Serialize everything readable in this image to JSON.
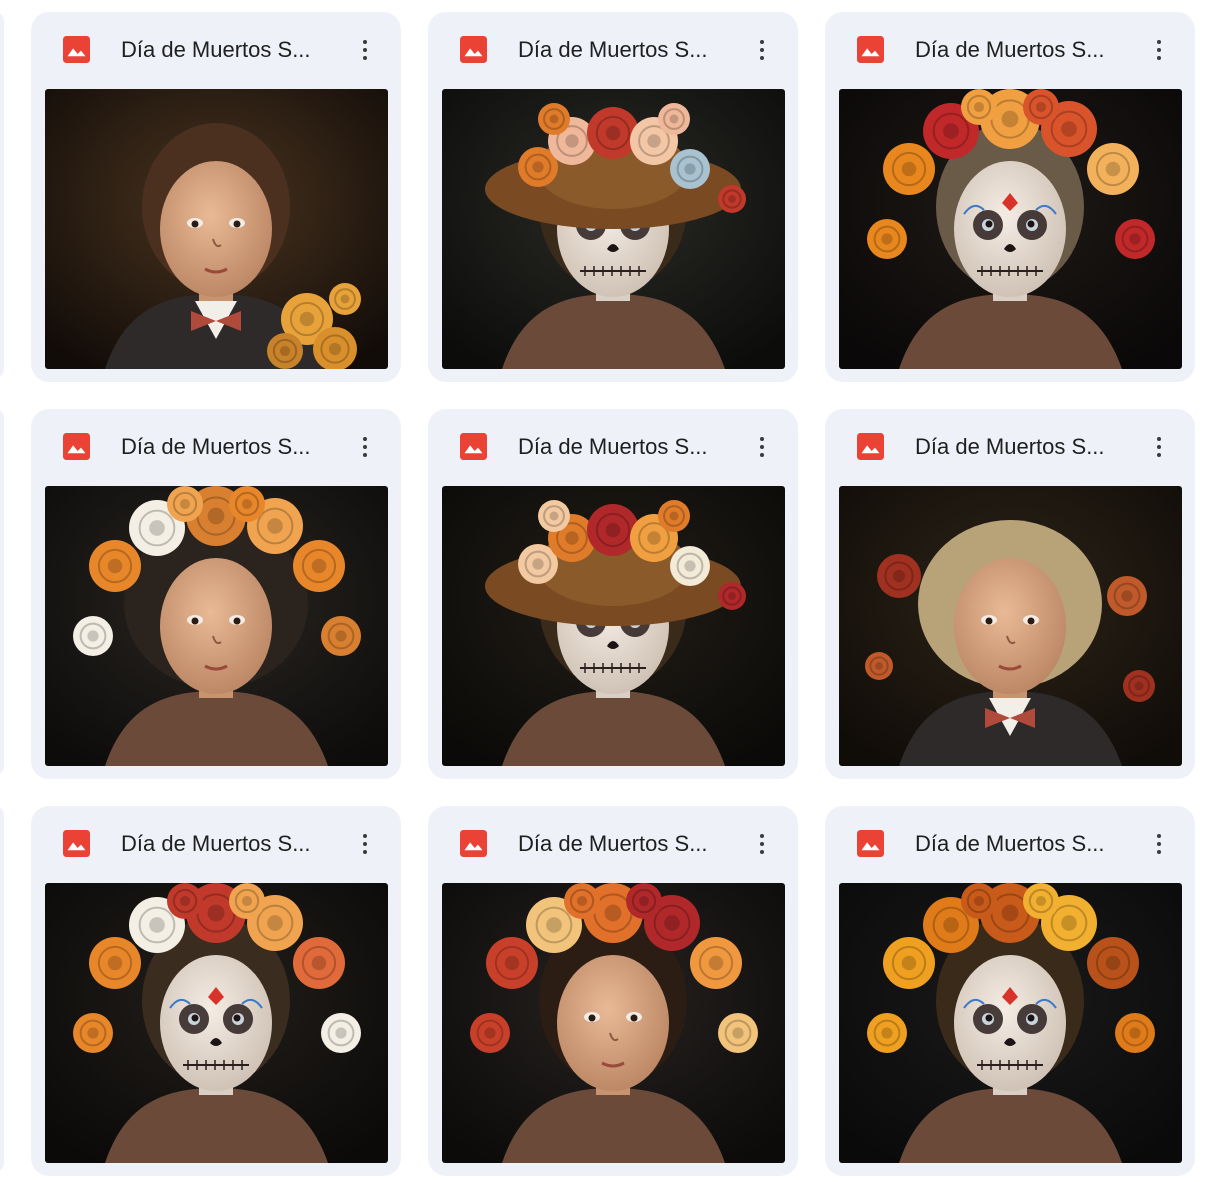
{
  "files": [
    {
      "title": "Día de Muertos S...",
      "icon": "image-file-icon",
      "thumb": "portrait-boy-suit-bowtie-flowers"
    },
    {
      "title": "Día de Muertos S...",
      "icon": "image-file-icon",
      "thumb": "portrait-child-hat-flowers-sugar-skull"
    },
    {
      "title": "Día de Muertos S...",
      "icon": "image-file-icon",
      "thumb": "portrait-boy-flower-crown-sugar-skull"
    },
    {
      "title": "Día de Muertos S...",
      "icon": "image-file-icon",
      "thumb": "portrait-girl-curly-hair-flowers"
    },
    {
      "title": "Día de Muertos S...",
      "icon": "image-file-icon",
      "thumb": "portrait-child-hat-sugar-skull-makeup"
    },
    {
      "title": "Día de Muertos S...",
      "icon": "image-file-icon",
      "thumb": "portrait-boy-curly-hair-bowtie"
    },
    {
      "title": "Día de Muertos S...",
      "icon": "image-file-icon",
      "thumb": "portrait-girl-flower-crown-sugar-skull"
    },
    {
      "title": "Día de Muertos S...",
      "icon": "image-file-icon",
      "thumb": "portrait-girl-flower-crown-necklace"
    },
    {
      "title": "Día de Muertos S...",
      "icon": "image-file-icon",
      "thumb": "portrait-child-marigold-crown-face-paint"
    }
  ],
  "colors": {
    "card_background": "#eef1f8",
    "image_icon_red": "#ea4335",
    "title_text": "#1f1f1f",
    "more_dots": "#3b3b3b"
  },
  "menu_icon": "more-vert-icon"
}
